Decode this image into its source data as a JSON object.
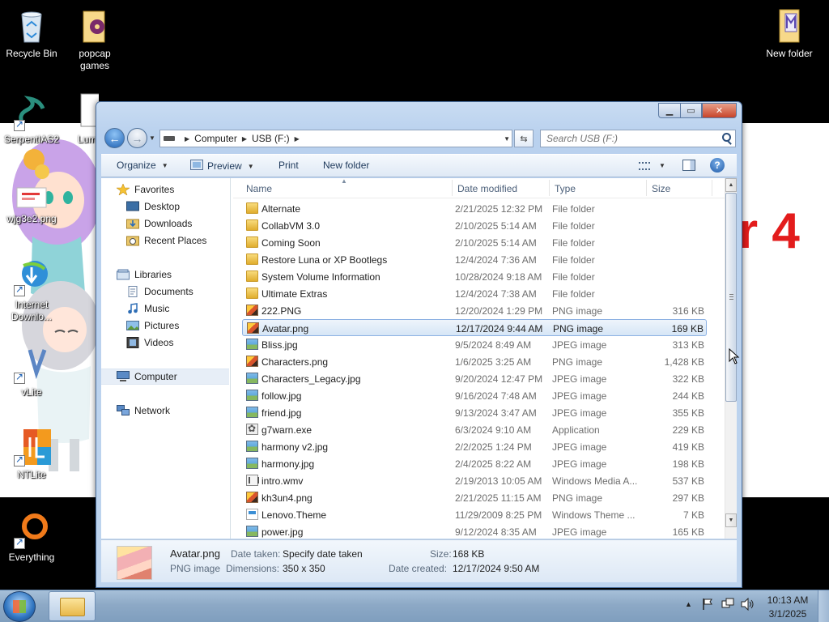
{
  "desktop": {
    "wallpaper_text": "r 4",
    "icons": [
      {
        "label": "Recycle Bin",
        "icon": "recycle-bin-icon"
      },
      {
        "label": "popcap games",
        "icon": "folder-icon"
      },
      {
        "label": "New folder",
        "icon": "folder-icon"
      },
      {
        "label": "SerpentIAS2",
        "icon": "serpent-icon"
      },
      {
        "label": "Lumi",
        "icon": "document-icon"
      },
      {
        "label": "wjg3e2.png",
        "icon": "image-icon"
      },
      {
        "label": "Internet Downlo...",
        "icon": "internet-download-manager-icon"
      },
      {
        "label": "vLite",
        "icon": "vlite-icon"
      },
      {
        "label": "NTLite",
        "icon": "ntlite-icon"
      },
      {
        "label": "Everything",
        "icon": "everything-search-icon"
      }
    ]
  },
  "explorer": {
    "address": {
      "crumbs": [
        "Computer",
        "USB (F:)"
      ]
    },
    "search": {
      "placeholder": "Search USB (F:)"
    },
    "toolbar": {
      "organize": "Organize",
      "preview": "Preview",
      "print": "Print",
      "new_folder": "New folder"
    },
    "nav_pane": {
      "favorites": "Favorites",
      "favorites_items": [
        "Desktop",
        "Downloads",
        "Recent Places"
      ],
      "libraries": "Libraries",
      "libraries_items": [
        "Documents",
        "Music",
        "Pictures",
        "Videos"
      ],
      "computer": "Computer",
      "network": "Network"
    },
    "columns": {
      "name": "Name",
      "date": "Date modified",
      "type": "Type",
      "size": "Size"
    },
    "files": [
      {
        "name": "Alternate",
        "date": "2/21/2025 12:32 PM",
        "type": "File folder",
        "size": "",
        "icon": "folder-icon"
      },
      {
        "name": "CollabVM 3.0",
        "date": "2/10/2025 5:14 AM",
        "type": "File folder",
        "size": "",
        "icon": "folder-icon"
      },
      {
        "name": "Coming Soon",
        "date": "2/10/2025 5:14 AM",
        "type": "File folder",
        "size": "",
        "icon": "folder-icon"
      },
      {
        "name": "Restore Luna or XP Bootlegs",
        "date": "12/4/2024 7:36 AM",
        "type": "File folder",
        "size": "",
        "icon": "folder-icon"
      },
      {
        "name": "System Volume Information",
        "date": "10/28/2024 9:18 AM",
        "type": "File folder",
        "size": "",
        "icon": "folder-icon"
      },
      {
        "name": "Ultimate Extras",
        "date": "12/4/2024 7:38 AM",
        "type": "File folder",
        "size": "",
        "icon": "folder-icon"
      },
      {
        "name": "222.PNG",
        "date": "12/20/2024 1:29 PM",
        "type": "PNG image",
        "size": "316 KB",
        "icon": "png-image-icon"
      },
      {
        "name": "Avatar.png",
        "date": "12/17/2024 9:44 AM",
        "type": "PNG image",
        "size": "169 KB",
        "icon": "png-image-icon",
        "selected": true
      },
      {
        "name": "Bliss.jpg",
        "date": "9/5/2024 8:49 AM",
        "type": "JPEG image",
        "size": "313 KB",
        "icon": "jpeg-image-icon"
      },
      {
        "name": "Characters.png",
        "date": "1/6/2025 3:25 AM",
        "type": "PNG image",
        "size": "1,428 KB",
        "icon": "png-image-icon"
      },
      {
        "name": "Characters_Legacy.jpg",
        "date": "9/20/2024 12:47 PM",
        "type": "JPEG image",
        "size": "322 KB",
        "icon": "jpeg-image-icon"
      },
      {
        "name": "follow.jpg",
        "date": "9/16/2024 7:48 AM",
        "type": "JPEG image",
        "size": "244 KB",
        "icon": "jpeg-image-icon"
      },
      {
        "name": "friend.jpg",
        "date": "9/13/2024 3:47 AM",
        "type": "JPEG image",
        "size": "355 KB",
        "icon": "jpeg-image-icon"
      },
      {
        "name": "g7warn.exe",
        "date": "6/3/2024 9:10 AM",
        "type": "Application",
        "size": "229 KB",
        "icon": "application-icon"
      },
      {
        "name": "harmony v2.jpg",
        "date": "2/2/2025 1:24 PM",
        "type": "JPEG image",
        "size": "419 KB",
        "icon": "jpeg-image-icon"
      },
      {
        "name": "harmony.jpg",
        "date": "2/4/2025 8:22 AM",
        "type": "JPEG image",
        "size": "198 KB",
        "icon": "jpeg-image-icon"
      },
      {
        "name": "intro.wmv",
        "date": "2/19/2013 10:05 AM",
        "type": "Windows Media A...",
        "size": "537 KB",
        "icon": "video-file-icon"
      },
      {
        "name": "kh3un4.png",
        "date": "2/21/2025 11:15 AM",
        "type": "PNG image",
        "size": "297 KB",
        "icon": "png-image-icon"
      },
      {
        "name": "Lenovo.Theme",
        "date": "11/29/2009 8:25 PM",
        "type": "Windows Theme ...",
        "size": "7 KB",
        "icon": "theme-file-icon"
      },
      {
        "name": "power.jpg",
        "date": "9/12/2024 8:35 AM",
        "type": "JPEG image",
        "size": "165 KB",
        "icon": "jpeg-image-icon"
      }
    ],
    "details": {
      "filename": "Avatar.png",
      "filetype": "PNG image",
      "date_taken_label": "Date taken:",
      "date_taken_value": "Specify date taken",
      "dimensions_label": "Dimensions:",
      "dimensions_value": "350 x 350",
      "size_label": "Size:",
      "size_value": "168 KB",
      "date_created_label": "Date created:",
      "date_created_value": "12/17/2024 9:50 AM"
    }
  },
  "taskbar": {
    "time": "10:13 AM",
    "date": "3/1/2025"
  }
}
